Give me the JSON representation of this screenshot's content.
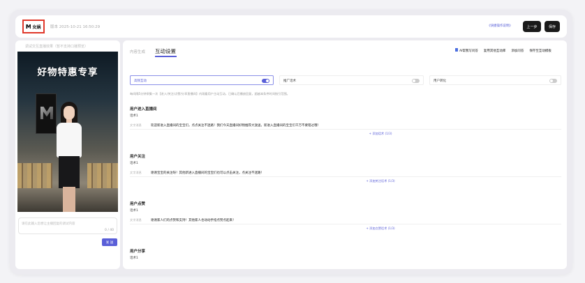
{
  "topbar": {
    "logo_label": "女娲",
    "version": "版本 2025-10-21 16:50:29",
    "shortcut_link": "《快捷操作说明》",
    "prev_label": "上一步",
    "save_label": "保存"
  },
  "left": {
    "bg_note": "调试交互直播效果（暂不支持口播预览）",
    "banner": "好物特惠专享",
    "prompt_placeholder": "请在此输入您想让主播回复的调试内容",
    "prompt_counter": "0 / 40",
    "send_label": "发 送"
  },
  "main": {
    "tab_inactive": "内容生成",
    "tab_active": "互动设置",
    "actions": [
      "AI帮我写问答",
      "复用其他互动库",
      "添加问答",
      "保存至互动模板"
    ],
    "toggles": [
      {
        "label": "高频互动",
        "on": true
      },
      {
        "label": "推广话术",
        "on": false
      },
      {
        "label": "用户转化",
        "on": false
      }
    ],
    "description": "每间隔5分钟采集一次【进入/关注/点赞/分享直播间】内观看用户主动互动，已确认后播放回复，超越本条件时间指引范围。",
    "sections": [
      {
        "title": "用户进入直播间",
        "sub": "话术1",
        "tag": "文字消息",
        "text": "欢迎新进入直播间的宝宝们，点点关注不迷路！我们今天直播间好物推荐大放送，新进入直播间的宝宝们千万不要错过哦！",
        "add": "+ 添加话术 (1/3)"
      },
      {
        "title": "用户关注",
        "sub": "话术1",
        "tag": "文字消息",
        "text": "谢谢宝宝的关注呀！其他新进入直播间的宝宝们也可以点击关注，点关注不迷路！",
        "add": "+ 添加关注话术 (1/3)"
      },
      {
        "title": "用户点赞",
        "sub": "话术1",
        "tag": "文字消息",
        "text": "谢谢家人们的点赞和支持！其他家人也动动手指点赞点起来！",
        "add": "+ 添加点赞话术 (1/3)"
      },
      {
        "title": "用户分享",
        "sub": "话术1",
        "tag": "",
        "text": "",
        "add": ""
      }
    ]
  },
  "colors": {
    "accent": "#5a5fd8",
    "highlight_border": "#e0372a",
    "dark_button": "#1a1a1a"
  }
}
